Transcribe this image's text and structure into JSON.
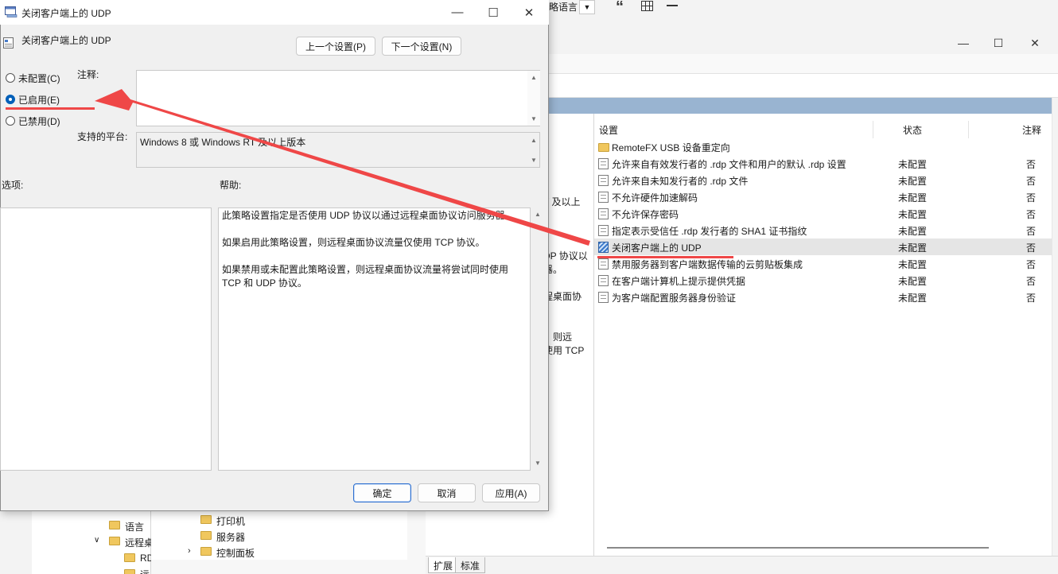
{
  "bg_window": {
    "left_pane_fragments": [
      "T 及以上",
      "DP 协议以",
      "器。",
      "程桌面协",
      "，则远",
      "使用 TCP"
    ],
    "list": {
      "columns": [
        "设置",
        "状态",
        "注释"
      ],
      "rows": [
        {
          "name": "RemoteFX USB 设备重定向",
          "state": "",
          "note": "",
          "icon": "folder-icon"
        },
        {
          "name": "允许来自有效发行者的 .rdp 文件和用户的默认 .rdp 设置",
          "state": "未配置",
          "note": "否",
          "icon": "policy-doc-icon"
        },
        {
          "name": "允许来自未知发行者的 .rdp 文件",
          "state": "未配置",
          "note": "否",
          "icon": "policy-doc-icon"
        },
        {
          "name": "不允许硬件加速解码",
          "state": "未配置",
          "note": "否",
          "icon": "policy-doc-icon"
        },
        {
          "name": "不允许保存密码",
          "state": "未配置",
          "note": "否",
          "icon": "policy-doc-icon"
        },
        {
          "name": "指定表示受信任 .rdp 发行者的 SHA1 证书指纹",
          "state": "未配置",
          "note": "否",
          "icon": "policy-doc-icon"
        },
        {
          "name": "关闭客户端上的 UDP",
          "state": "未配置",
          "note": "否",
          "icon": "policy-doc-icon",
          "selected": true
        },
        {
          "name": "禁用服务器到客户端数据传输的云剪贴板集成",
          "state": "未配置",
          "note": "否",
          "icon": "policy-doc-icon"
        },
        {
          "name": "在客户端计算机上提示提供凭据",
          "state": "未配置",
          "note": "否",
          "icon": "policy-doc-icon"
        },
        {
          "name": "为客户端配置服务器身份验证",
          "state": "未配置",
          "note": "否",
          "icon": "policy-doc-icon"
        }
      ]
    },
    "tabs": [
      "扩展",
      "标准"
    ]
  },
  "toolbar_fragment": {
    "lang_text": "略语言"
  },
  "tree_left": {
    "items": [
      "语言",
      "远程桌",
      "RD",
      "远"
    ]
  },
  "tree_right": {
    "items": [
      "打印机",
      "服务器",
      "控制面板"
    ]
  },
  "dialog": {
    "title": "关闭客户端上的 UDP",
    "policy_name": "关闭客户端上的 UDP",
    "prev_button": "上一个设置(P)",
    "next_button": "下一个设置(N)",
    "radios": [
      {
        "label": "未配置(C)",
        "checked": false
      },
      {
        "label": "已启用(E)",
        "checked": true
      },
      {
        "label": "已禁用(D)",
        "checked": false
      }
    ],
    "comment_label": "注释:",
    "platform_label": "支持的平台:",
    "platform_value": "Windows 8 或 Windows RT 及以上版本",
    "options_label": "选项:",
    "help_label": "帮助:",
    "help_text": "此策略设置指定是否使用 UDP 协议以通过远程桌面协议访问服务器。\n\n如果启用此策略设置，则远程桌面协议流量仅使用 TCP 协议。\n\n如果禁用或未配置此策略设置，则远程桌面协议流量将尝试同时使用 TCP 和 UDP 协议。",
    "ok_button": "确定",
    "cancel_button": "取消",
    "apply_button": "应用(A)"
  },
  "annotation_color": "#ef4747"
}
